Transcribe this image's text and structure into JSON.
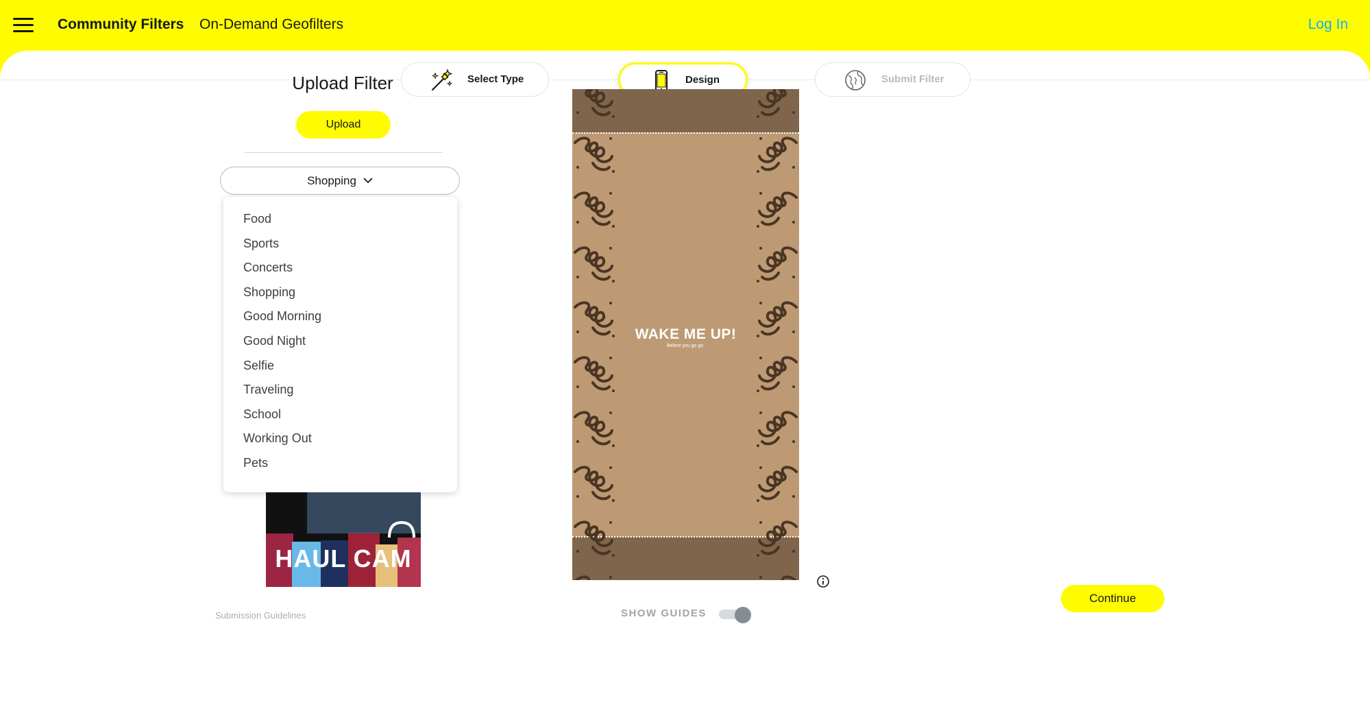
{
  "header": {
    "menu_icon": "hamburger-menu-icon",
    "nav_links": [
      "Community Filters",
      "On-Demand Geofilters"
    ],
    "login_label": "Log In",
    "accent_color": "#FFFC00",
    "login_color": "#0FADFF"
  },
  "stepper": {
    "steps": [
      {
        "label": "Select Type",
        "icon": "magic-wand-icon",
        "state": "completed"
      },
      {
        "label": "Design",
        "icon": "phone-icon",
        "state": "active"
      },
      {
        "label": "Submit Filter",
        "icon": "globe-icon",
        "state": "inactive"
      }
    ]
  },
  "upload": {
    "title": "Upload Filter",
    "button_label": "Upload"
  },
  "category": {
    "selected": "Shopping",
    "options": [
      "Food",
      "Sports",
      "Concerts",
      "Shopping",
      "Good Morning",
      "Good Night",
      "Selfie",
      "Traveling",
      "School",
      "Working Out",
      "Pets"
    ]
  },
  "thumbnail": {
    "text": "HAUL CAM"
  },
  "footer_left": {
    "guidelines_label": "Submission Guidelines"
  },
  "preview": {
    "title": "WAKE ME UP!",
    "subtitle": "Before you go go.",
    "background_color": "#BD9A74",
    "bar_color": "#7F654C"
  },
  "guides": {
    "label": "SHOW GUIDES",
    "enabled": true
  },
  "continue_label": "Continue"
}
